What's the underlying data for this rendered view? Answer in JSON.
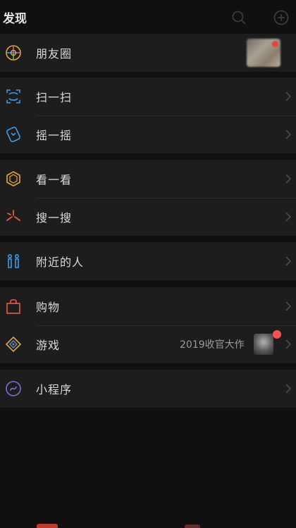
{
  "header": {
    "title": "发现",
    "search_icon": "search-icon",
    "add_icon": "plus-circle-icon"
  },
  "menu": {
    "moments": {
      "label": "朋友圈",
      "icon": "moments-icon"
    },
    "scan": {
      "label": "扫一扫",
      "icon": "scan-icon"
    },
    "shake": {
      "label": "摇一摇",
      "icon": "shake-icon"
    },
    "top_stories": {
      "label": "看一看",
      "icon": "top-stories-icon"
    },
    "search": {
      "label": "搜一搜",
      "icon": "search-feature-icon"
    },
    "nearby": {
      "label": "附近的人",
      "icon": "people-nearby-icon"
    },
    "shopping": {
      "label": "购物",
      "icon": "shopping-bag-icon"
    },
    "games": {
      "label": "游戏",
      "icon": "games-icon",
      "promo": "2019收官大作"
    },
    "mini_programs": {
      "label": "小程序",
      "icon": "mini-programs-icon"
    }
  },
  "colors": {
    "background": "#0f100f",
    "row": "#1c1d1c",
    "badge": "#fa5151"
  }
}
